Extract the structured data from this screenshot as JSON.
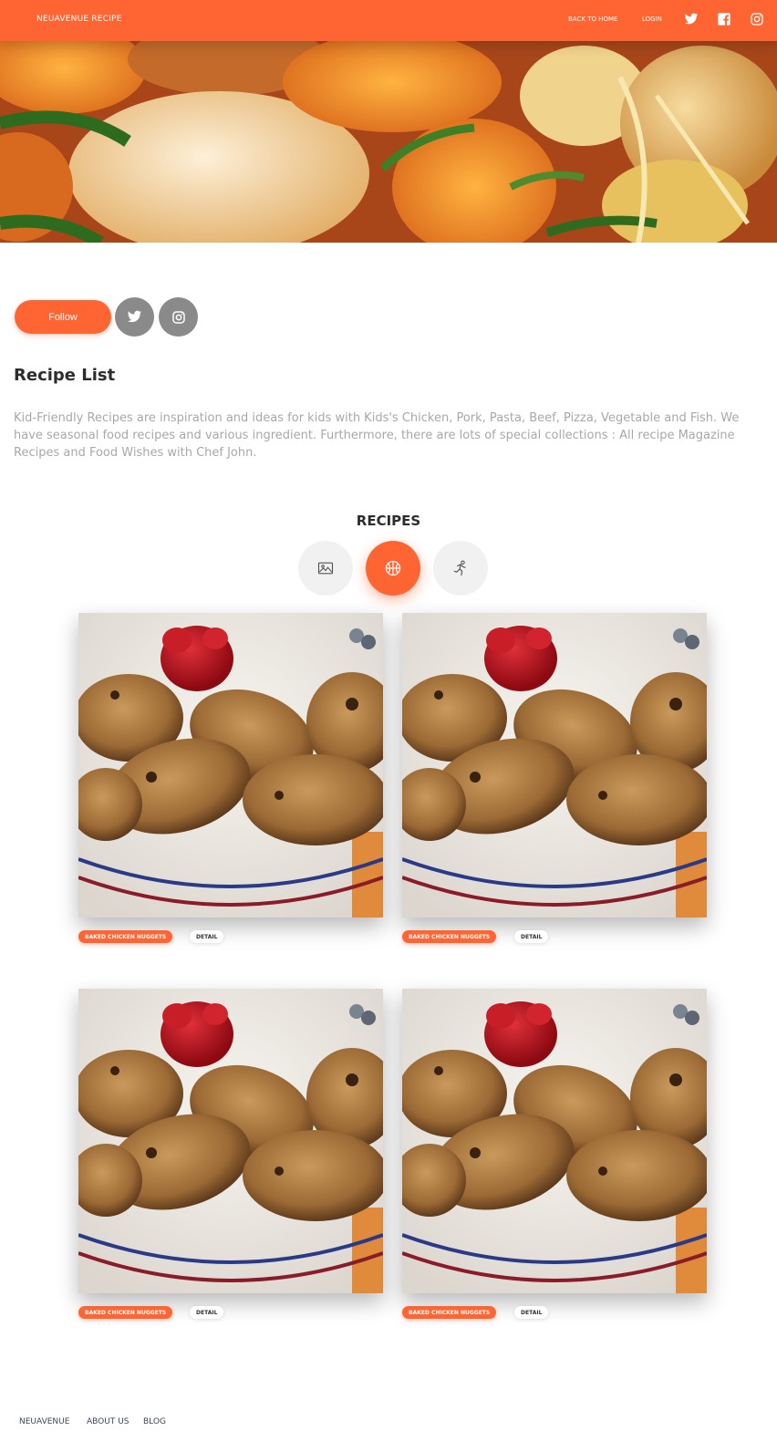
{
  "navbar": {
    "brand": "NEUAVENUE RECIPE",
    "links": [
      "BACK TO HOME",
      "LOGIN"
    ],
    "icons": [
      "twitter-icon",
      "facebook-icon",
      "instagram-icon"
    ],
    "accent": "#ff6433"
  },
  "profile": {
    "follow_label": "Follow",
    "social_icons": [
      "twitter-icon",
      "instagram-icon"
    ]
  },
  "main": {
    "title": "Recipe List",
    "description": "Kid-Friendly Recipes are inspiration and ideas for kids with Kids's Chicken, Pork, Pasta, Beef, Pizza, Vegetable and Fish. We have seasonal food recipes and various ingredient. Furthermore, there are lots of special collections : All recipe Magazine Recipes and Food Wishes with Chef John."
  },
  "recipes": {
    "section_title": "RECIPES",
    "tabs": [
      {
        "icon": "image-icon",
        "active": false
      },
      {
        "icon": "basketball-icon",
        "active": true
      },
      {
        "icon": "runner-icon",
        "active": false
      }
    ],
    "cards": [
      {
        "tag": "BAKED CHICKEN NUGGETS",
        "detail": "DETAIL"
      },
      {
        "tag": "BAKED CHICKEN NUGGETS",
        "detail": "DETAIL"
      },
      {
        "tag": "BAKED CHICKEN NUGGETS",
        "detail": "DETAIL"
      },
      {
        "tag": "BAKED CHICKEN NUGGETS",
        "detail": "DETAIL"
      }
    ]
  },
  "footer": {
    "links": [
      "NEUAVENUE",
      "ABOUT US",
      "BLOG"
    ]
  }
}
